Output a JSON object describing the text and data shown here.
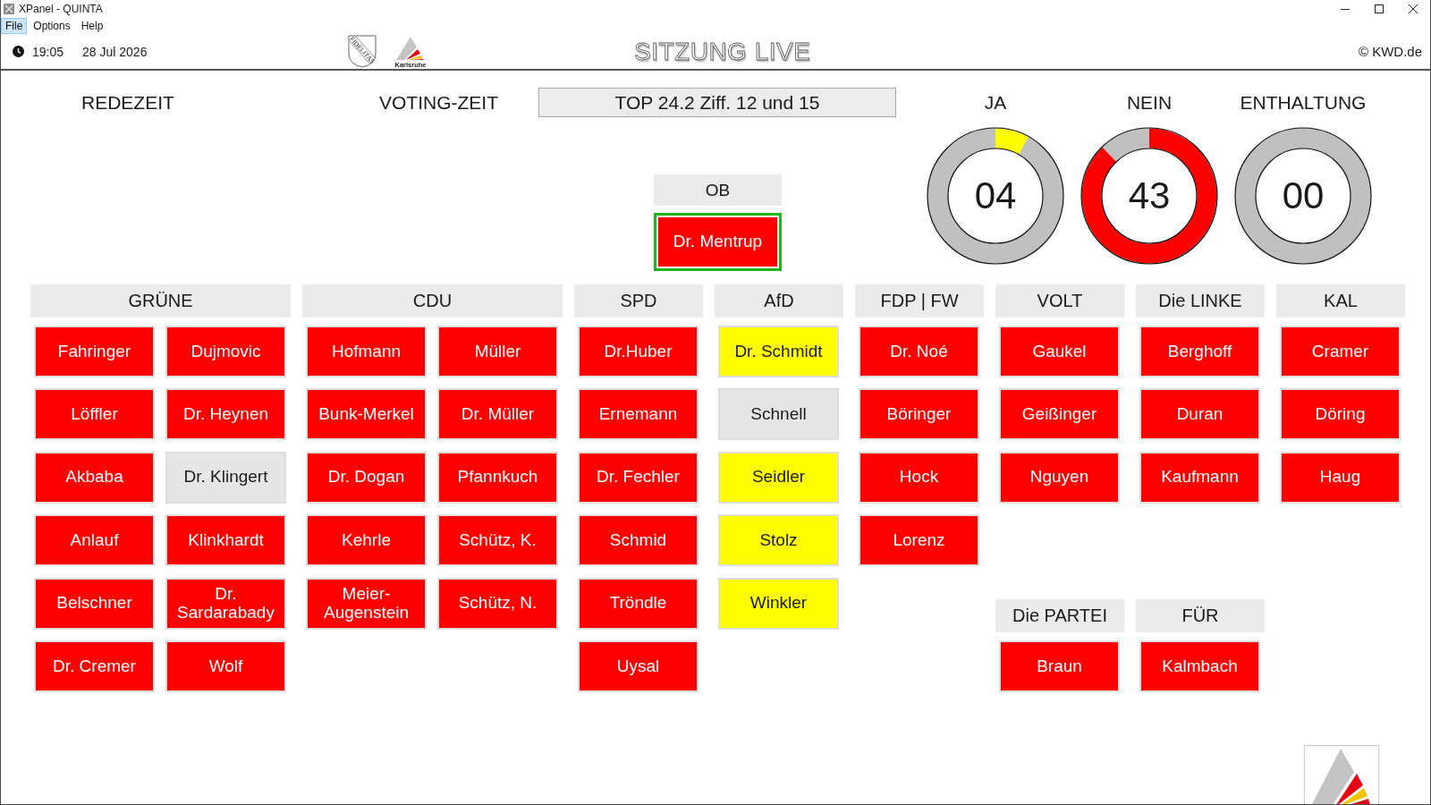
{
  "window": {
    "title": "XPanel - QUINTA"
  },
  "menu": [
    {
      "label": "File",
      "selected": true
    },
    {
      "label": "Options",
      "selected": false
    },
    {
      "label": "Help",
      "selected": false
    }
  ],
  "header": {
    "time": "19:05",
    "date": "28 Jul 2026",
    "shield_motto": "FIDELITAS",
    "logo_caption": "Karlsruhe",
    "title": "SITZUNG LIVE",
    "copyright": "© KWD.de"
  },
  "timers": {
    "speaking_time_label": "REDEZEIT",
    "voting_time_label": "VOTING-ZEIT",
    "agenda_item": "TOP 24.2 Ziff. 12 und 15"
  },
  "votes": [
    {
      "label": "JA",
      "count": "04",
      "color": "#ffff00"
    },
    {
      "label": "NEIN",
      "count": "43",
      "color": "#ff0000"
    },
    {
      "label": "ENTHALTUNG",
      "count": "00"
    }
  ],
  "mayor": {
    "name": "OB",
    "members": [
      {
        "name": "Dr. Mentrup",
        "color": "#ff0000",
        "highlighted": true
      }
    ]
  },
  "party_columns": [
    {
      "parties": [
        {
          "name": "GRÜNE",
          "members": [
            {
              "name": "Fahringer",
              "color": "#ff0000"
            },
            {
              "name": "Dujmovic",
              "color": "#ff0000"
            },
            {
              "name": "Löffler",
              "color": "#ff0000"
            },
            {
              "name": "Dr. Heynen",
              "color": "#ff0000"
            },
            {
              "name": "Akbaba",
              "color": "#ff0000"
            },
            {
              "name": "Dr. Klingert",
              "color": "#e6e6e6"
            },
            {
              "name": "Anlauf",
              "color": "#ff0000"
            },
            {
              "name": "Klinkhardt",
              "color": "#ff0000"
            },
            {
              "name": "Belschner",
              "color": "#ff0000"
            },
            {
              "name": "Dr. Sardarabady",
              "color": "#ff0000"
            },
            {
              "name": "Dr. Cremer",
              "color": "#ff0000"
            },
            {
              "name": "Wolf",
              "color": "#ff0000"
            }
          ]
        }
      ]
    },
    {
      "parties": [
        {
          "name": "CDU",
          "members": [
            {
              "name": "Hofmann",
              "color": "#ff0000"
            },
            {
              "name": "Müller",
              "color": "#ff0000"
            },
            {
              "name": "Bunk-Merkel",
              "color": "#ff0000"
            },
            {
              "name": "Dr. Müller",
              "color": "#ff0000"
            },
            {
              "name": "Dr. Dogan",
              "color": "#ff0000"
            },
            {
              "name": "Pfannkuch",
              "color": "#ff0000"
            },
            {
              "name": "Kehrle",
              "color": "#ff0000"
            },
            {
              "name": "Schütz, K.",
              "color": "#ff0000"
            },
            {
              "name": "Meier-Augenstein",
              "color": "#ff0000"
            },
            {
              "name": "Schütz, N.",
              "color": "#ff0000"
            }
          ]
        }
      ]
    },
    {
      "parties": [
        {
          "name": "SPD",
          "members": [
            {
              "name": "Dr.Huber",
              "color": "#ff0000"
            },
            {
              "name": "Ernemann",
              "color": "#ff0000"
            },
            {
              "name": "Dr. Fechler",
              "color": "#ff0000"
            },
            {
              "name": "Schmid",
              "color": "#ff0000"
            },
            {
              "name": "Tröndle",
              "color": "#ff0000"
            },
            {
              "name": "Uysal",
              "color": "#ff0000"
            }
          ]
        }
      ]
    },
    {
      "parties": [
        {
          "name": "AfD",
          "members": [
            {
              "name": "Dr. Schmidt",
              "color": "#ffff00"
            },
            {
              "name": "Schnell",
              "color": "#e6e6e6"
            },
            {
              "name": "Seidler",
              "color": "#ffff00"
            },
            {
              "name": "Stolz",
              "color": "#ffff00"
            },
            {
              "name": "Winkler",
              "color": "#ffff00"
            }
          ]
        }
      ]
    },
    {
      "parties": [
        {
          "name": "FDP | FW",
          "members": [
            {
              "name": "Dr. Noé",
              "color": "#ff0000"
            },
            {
              "name": "Böringer",
              "color": "#ff0000"
            },
            {
              "name": "Hock",
              "color": "#ff0000"
            },
            {
              "name": "Lorenz",
              "color": "#ff0000"
            }
          ]
        }
      ]
    },
    {
      "parties": [
        {
          "name": "VOLT",
          "members": [
            {
              "name": "Gaukel",
              "color": "#ff0000"
            },
            {
              "name": "Geißinger",
              "color": "#ff0000"
            },
            {
              "name": "Nguyen",
              "color": "#ff0000"
            }
          ]
        },
        {
          "name": "Die PARTEI",
          "members": [
            {
              "name": "Braun",
              "color": "#ff0000"
            }
          ]
        }
      ]
    },
    {
      "parties": [
        {
          "name": "Die LINKE",
          "members": [
            {
              "name": "Berghoff",
              "color": "#ff0000"
            },
            {
              "name": "Duran",
              "color": "#ff0000"
            },
            {
              "name": "Kaufmann",
              "color": "#ff0000"
            }
          ]
        },
        {
          "name": "FÜR",
          "members": [
            {
              "name": "Kalmbach",
              "color": "#ff0000"
            }
          ]
        }
      ]
    },
    {
      "parties": [
        {
          "name": "KAL",
          "members": [
            {
              "name": "Cramer",
              "color": "#ff0000"
            },
            {
              "name": "Döring",
              "color": "#ff0000"
            },
            {
              "name": "Haug",
              "color": "#ff0000"
            }
          ]
        }
      ]
    }
  ]
}
